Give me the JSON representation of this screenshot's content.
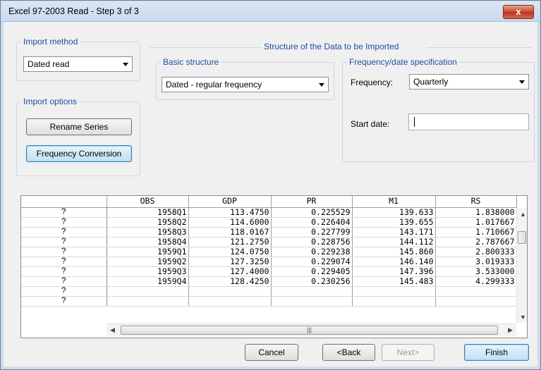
{
  "window": {
    "title": "Excel 97-2003 Read - Step 3 of 3",
    "close_glyph": "x"
  },
  "import_method": {
    "legend": "Import method",
    "value": "Dated read"
  },
  "import_options": {
    "legend": "Import options",
    "rename_label": "Rename Series",
    "freq_conv_label": "Frequency Conversion"
  },
  "structure": {
    "title": "Structure of the Data to be Imported",
    "basic": {
      "legend": "Basic structure",
      "value": "Dated - regular frequency"
    },
    "freq": {
      "legend": "Frequency/date specification",
      "frequency_label": "Frequency:",
      "frequency_value": "Quarterly",
      "start_label": "Start date:",
      "start_value": ""
    }
  },
  "grid": {
    "headers": [
      "OBS",
      "GDP",
      "PR",
      "M1",
      "RS"
    ],
    "rows": [
      {
        "hdr": "?",
        "cells": [
          "1958Q1",
          "113.4750",
          "0.225529",
          "139.633",
          "1.838000"
        ]
      },
      {
        "hdr": "?",
        "cells": [
          "1958Q2",
          "114.6000",
          "0.226404",
          "139.655",
          "1.017667"
        ]
      },
      {
        "hdr": "?",
        "cells": [
          "1958Q3",
          "118.0167",
          "0.227799",
          "143.171",
          "1.710667"
        ]
      },
      {
        "hdr": "?",
        "cells": [
          "1958Q4",
          "121.2750",
          "0.228756",
          "144.112",
          "2.787667"
        ]
      },
      {
        "hdr": "?",
        "cells": [
          "1959Q1",
          "124.0750",
          "0.229238",
          "145.860",
          "2.800333"
        ]
      },
      {
        "hdr": "?",
        "cells": [
          "1959Q2",
          "127.3250",
          "0.229074",
          "146.140",
          "3.019333"
        ]
      },
      {
        "hdr": "?",
        "cells": [
          "1959Q3",
          "127.4000",
          "0.229405",
          "147.396",
          "3.533000"
        ]
      },
      {
        "hdr": "?",
        "cells": [
          "1959Q4",
          "128.4250",
          "0.230256",
          "145.483",
          "4.299333"
        ]
      },
      {
        "hdr": "?",
        "cells": [
          "",
          "",
          "",
          "",
          ""
        ]
      },
      {
        "hdr": "?",
        "cells": [
          "",
          "",
          "",
          "",
          ""
        ]
      }
    ]
  },
  "buttons": {
    "cancel": "Cancel",
    "back": "<Back",
    "next": "Next>",
    "finish": "Finish"
  }
}
